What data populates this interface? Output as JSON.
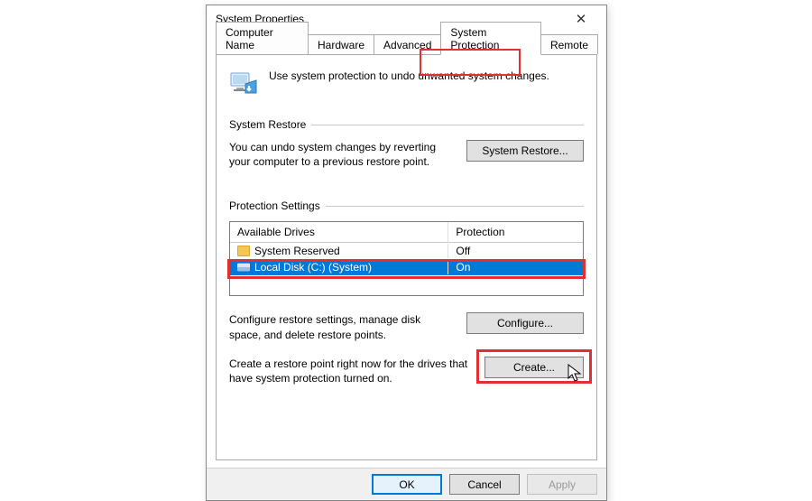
{
  "window": {
    "title": "System Properties"
  },
  "tabs": {
    "computer_name": "Computer Name",
    "hardware": "Hardware",
    "advanced": "Advanced",
    "system_protection": "System Protection",
    "remote": "Remote"
  },
  "intro": "Use system protection to undo unwanted system changes.",
  "system_restore": {
    "title": "System Restore",
    "desc": "You can undo system changes by reverting your computer to a previous restore point.",
    "button": "System Restore..."
  },
  "protection_settings": {
    "title": "Protection Settings",
    "header_drives": "Available Drives",
    "header_protection": "Protection",
    "rows": [
      {
        "name": "System Reserved",
        "protection": "Off",
        "icon": "folder",
        "selected": false
      },
      {
        "name": "Local Disk (C:) (System)",
        "protection": "On",
        "icon": "disk",
        "selected": true
      }
    ],
    "configure_desc": "Configure restore settings, manage disk space, and delete restore points.",
    "configure_button": "Configure...",
    "create_desc": "Create a restore point right now for the drives that have system protection turned on.",
    "create_button": "Create..."
  },
  "footer": {
    "ok": "OK",
    "cancel": "Cancel",
    "apply": "Apply"
  }
}
